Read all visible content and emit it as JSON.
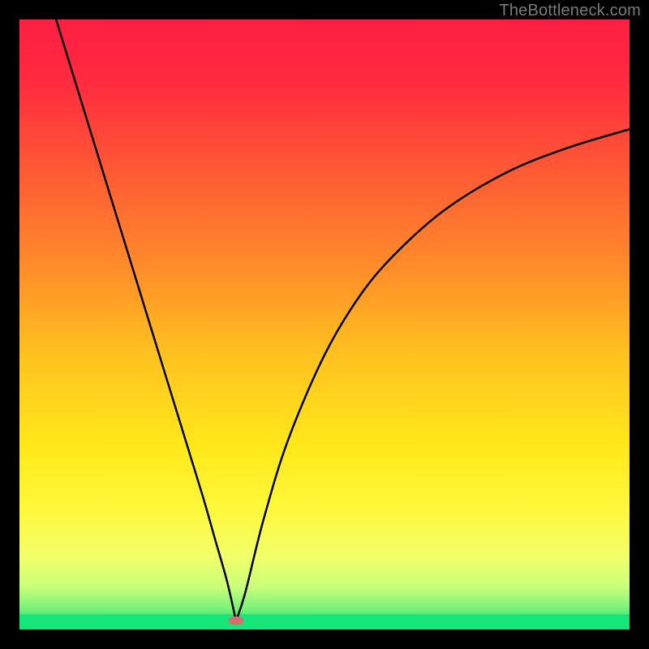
{
  "watermark": "TheBottleneck.com",
  "chart_data": {
    "type": "line",
    "title": "",
    "xlabel": "",
    "ylabel": "",
    "xlim": [
      0,
      100
    ],
    "ylim": [
      0,
      100
    ],
    "series": [
      {
        "name": "bottleneck-curve",
        "x": [
          6,
          10,
          14,
          18,
          22,
          26,
          30,
          32,
          34,
          35.5,
          37,
          40,
          44,
          50,
          56,
          62,
          70,
          80,
          90,
          100
        ],
        "values": [
          100,
          87,
          74,
          61,
          48,
          35,
          22,
          15,
          8,
          1.4,
          6,
          18,
          31,
          45,
          55,
          62,
          69,
          75,
          79,
          82
        ]
      }
    ],
    "minimum": {
      "x": 35.5,
      "y": 1.4
    },
    "baseline_band": {
      "y0": 0,
      "y1": 2.5,
      "color": "#15e67a"
    },
    "gradient_stops": [
      {
        "offset": 0.0,
        "color": "#ff1f43"
      },
      {
        "offset": 0.1,
        "color": "#ff2a3f"
      },
      {
        "offset": 0.25,
        "color": "#ff5a34"
      },
      {
        "offset": 0.4,
        "color": "#ff8a2a"
      },
      {
        "offset": 0.55,
        "color": "#ffc21f"
      },
      {
        "offset": 0.7,
        "color": "#ffe81a"
      },
      {
        "offset": 0.8,
        "color": "#fff83a"
      },
      {
        "offset": 0.88,
        "color": "#f2ff6a"
      },
      {
        "offset": 0.93,
        "color": "#c9ff7a"
      },
      {
        "offset": 0.965,
        "color": "#7af27a"
      },
      {
        "offset": 0.985,
        "color": "#2de67a"
      },
      {
        "offset": 1.0,
        "color": "#15e67a"
      }
    ]
  }
}
